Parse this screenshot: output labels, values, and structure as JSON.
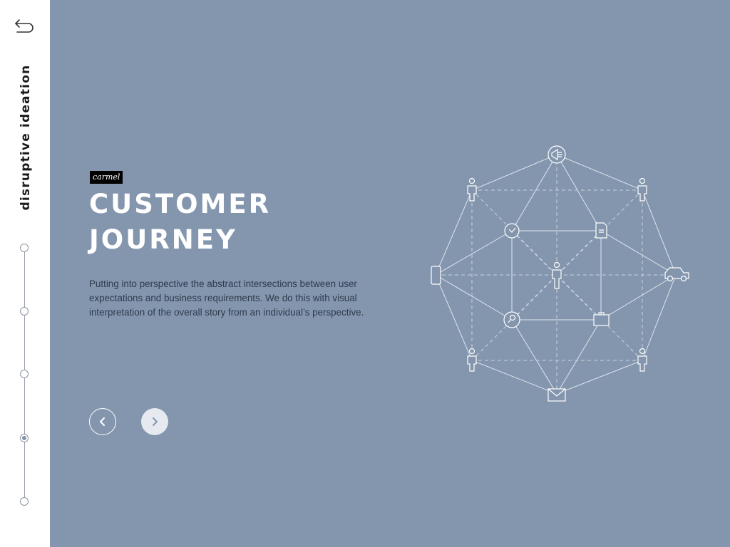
{
  "sidebar": {
    "title": "disruptive ideation",
    "timeline": {
      "count": 5,
      "active_index": 3
    }
  },
  "hero": {
    "brand": "carmel",
    "title_line1": "CUSTOMER",
    "title_line2": "JOURNEY",
    "description": "Putting into perspective the abstract intersections between user expectations and business requirements. We do this with visual interpretation of the overall story from an individual’s perspective."
  },
  "colors": {
    "main_background": "#8496ae",
    "sidebar_background": "#ffffff",
    "title": "#ffffff",
    "description": "#2e3a4b",
    "next_button": "#e6eaf0"
  },
  "icons": {
    "back": "back-arrow-icon",
    "prev": "chevron-left-icon",
    "next": "chevron-right-icon",
    "diagram_nodes": [
      "megaphone-icon",
      "person-icon",
      "person-icon",
      "clock-icon",
      "document-icon",
      "phone-icon",
      "person-icon",
      "car-icon",
      "search-icon",
      "briefcase-icon",
      "person-icon",
      "person-icon",
      "envelope-icon"
    ]
  }
}
